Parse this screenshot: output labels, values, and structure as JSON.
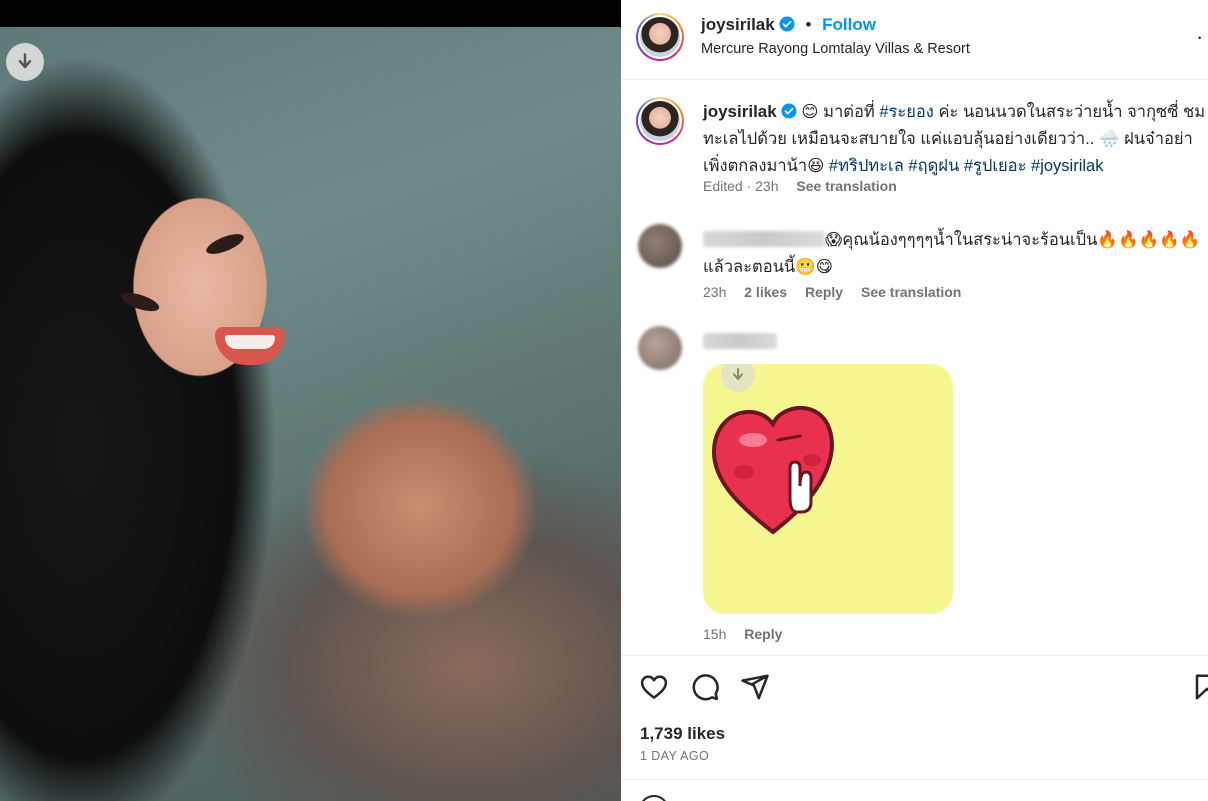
{
  "post": {
    "username": "joysirilak",
    "follow_label": "Follow",
    "separator": "•",
    "location": "Mercure Rayong Lomtalay Villas & Resort",
    "more_label": "·"
  },
  "caption": {
    "username": "joysirilak",
    "segments": [
      {
        "text": " 😊 มาต่อที่ ",
        "tag": false
      },
      {
        "text": "#ระยอง",
        "tag": true
      },
      {
        "text": " ค่ะ นอนนวดในสระว่ายน้ำ จากุซซี่ ชมทะเลไปด้วย เหมือนจะสบายใจ แค่แอบลุ้นอย่างเดียวว่า.. 🌧️ ฝนจ๋าอย่าเพิ่งตกลงมาน้า😆 ",
        "tag": false
      },
      {
        "text": "#ทริปทะเล",
        "tag": true
      },
      {
        "text": " ",
        "tag": false
      },
      {
        "text": "#ฤดูฝน",
        "tag": true
      },
      {
        "text": " ",
        "tag": false
      },
      {
        "text": "#รูปเยอะ",
        "tag": true
      },
      {
        "text": " ",
        "tag": false
      },
      {
        "text": "#joysirilak",
        "tag": true
      }
    ],
    "edited": "Edited · 23h",
    "see_translation": "See translation"
  },
  "comments": [
    {
      "text": "😱คุณน้องๆๆๆๆน้ำในสระน่าจะร้อนเป็น🔥🔥🔥🔥🔥แล้วละตอนนี้😬😋",
      "time": "23h",
      "likes": "2 likes",
      "reply": "Reply",
      "see_translation": "See translation"
    },
    {
      "time": "15h",
      "reply": "Reply"
    }
  ],
  "stats": {
    "likes": "1,739 likes",
    "ago": "1 DAY AGO"
  },
  "icons": [
    "download-icon",
    "verified-badge-icon",
    "heart-icon",
    "comment-icon",
    "share-icon",
    "save-icon"
  ],
  "colors": {
    "accent": "#0095f6",
    "hashtag": "#00376b",
    "muted": "#737373",
    "sticker_bg": "#f7f791"
  }
}
